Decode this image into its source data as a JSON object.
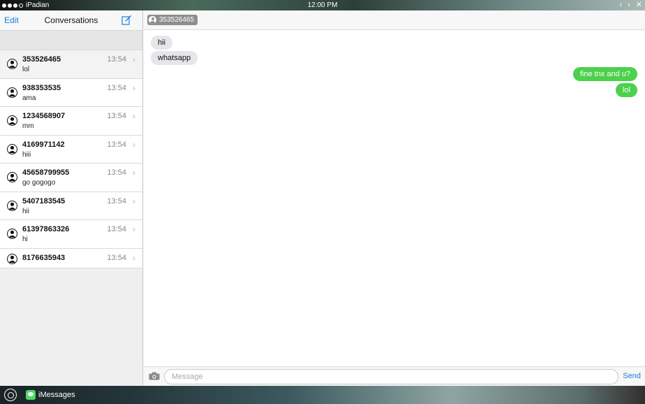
{
  "statusbar": {
    "app_name": "iPadian",
    "time": "12:00 PM",
    "controls": [
      "‹",
      "›",
      "✕"
    ]
  },
  "left": {
    "edit_label": "Edit",
    "title": "Conversations",
    "conversations": [
      {
        "name": "353526465",
        "preview": "lol",
        "time": "13:54"
      },
      {
        "name": "938353535",
        "preview": "ama",
        "time": "13:54"
      },
      {
        "name": "1234568907",
        "preview": "mm",
        "time": "13:54"
      },
      {
        "name": "4169971142",
        "preview": "hiii",
        "time": "13:54"
      },
      {
        "name": "45658799955",
        "preview": "go gogogo",
        "time": "13:54"
      },
      {
        "name": "5407183545",
        "preview": "hii",
        "time": "13:54"
      },
      {
        "name": "61397863326",
        "preview": "hi",
        "time": "13:54"
      },
      {
        "name": "8176635943",
        "preview": "",
        "time": "13:54"
      }
    ]
  },
  "right": {
    "recipient": "353526465",
    "messages": [
      {
        "text": "hii",
        "direction": "in"
      },
      {
        "text": "whatsapp",
        "direction": "in"
      },
      {
        "text": "fine tnx and u?",
        "direction": "out"
      },
      {
        "text": "lol",
        "direction": "out"
      }
    ],
    "composer": {
      "placeholder": "Message",
      "value": "",
      "send_label": "Send"
    }
  },
  "taskbar": {
    "app_label": "iMessages"
  },
  "colors": {
    "accent": "#1a7de0",
    "outgoing_bubble": "#4cd14c",
    "incoming_bubble": "#e5e5ea"
  }
}
